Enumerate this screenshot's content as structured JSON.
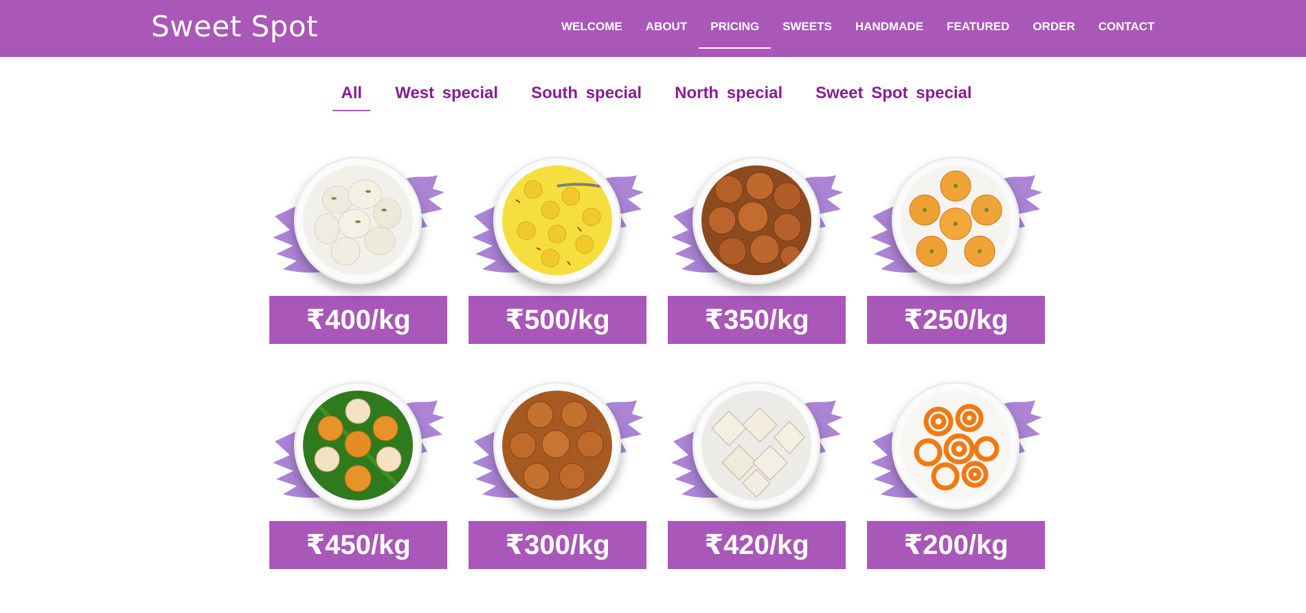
{
  "brand": "Sweet Spot",
  "nav": {
    "items": [
      {
        "label": "WELCOME"
      },
      {
        "label": "ABOUT"
      },
      {
        "label": "PRICING",
        "active": true
      },
      {
        "label": "SWEETS"
      },
      {
        "label": "HANDMADE"
      },
      {
        "label": "FEATURED"
      },
      {
        "label": "ORDER"
      },
      {
        "label": "CONTACT"
      }
    ]
  },
  "filters": {
    "tabs": [
      {
        "label": "All",
        "active": true
      },
      {
        "label": "West special"
      },
      {
        "label": "South special"
      },
      {
        "label": "North special"
      },
      {
        "label": "Sweet Spot special"
      }
    ]
  },
  "products": [
    {
      "price": "₹400/kg",
      "image": "rasgulla-bowl-image"
    },
    {
      "price": "₹500/kg",
      "image": "rasmalai-bowl-image"
    },
    {
      "price": "₹350/kg",
      "image": "gulab-jamun-bowl-image"
    },
    {
      "price": "₹250/kg",
      "image": "ladoo-plate-image"
    },
    {
      "price": "₹450/kg",
      "image": "modak-plate-image"
    },
    {
      "price": "₹300/kg",
      "image": "gulab-jamun-syrup-bowl-image"
    },
    {
      "price": "₹420/kg",
      "image": "kaju-katli-plate-image"
    },
    {
      "price": "₹200/kg",
      "image": "jalebi-plate-image"
    }
  ],
  "colors": {
    "brand_purple": "#a957b8",
    "tab_text": "#8a1a99",
    "brush_purple": "#a87dd4"
  }
}
